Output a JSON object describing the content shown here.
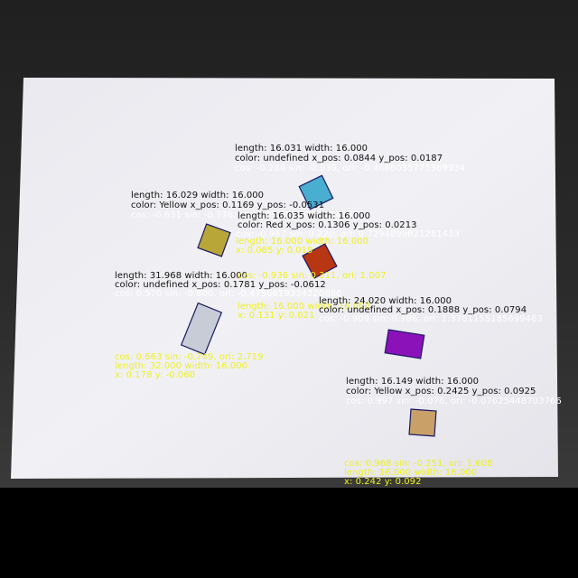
{
  "colors": {
    "paper": "#eeeef2",
    "label_dark": "#111111",
    "label_white": "#ffffff",
    "label_yellow": "#f0f020",
    "outline": "#1a1a66"
  },
  "objects": [
    {
      "name": "cyan",
      "fill": "#4aaed0",
      "lines": {
        "dims": "length: 16.031 width: 16.000",
        "color_pos": "color: undefined x_pos: 0.0844 y_pos: 0.0187",
        "trig": "cos: -0.286 sin: -0.939, ori: -0.4666035771369934"
      }
    },
    {
      "name": "olive",
      "fill": "#b8a638",
      "lines": {
        "dims": "length: 16.029 width: 16.000",
        "color_pos": "color: Yellow x_pos: 0.1169 y_pos: -0.0531",
        "trig": "cos: -0.631 sin: -0.776, ori: 0.8928356178204097"
      }
    },
    {
      "name": "red",
      "fill": "#b83612",
      "lines": {
        "dims": "length: 16.035 width: 16.000",
        "color_pos": "color: Red x_pos: 0.1306 y_pos: 0.0213",
        "trig": "cos: -0.967 sin: 0.220, ori: 0.7294899821281433",
        "overlay_dims": "length: 16.000 width: 16.000",
        "overlay_xy": "x: 0.085 y: 0.019"
      }
    },
    {
      "name": "grey",
      "fill": "#c7ccd6",
      "lines": {
        "dims": "length: 31.968 width: 16.000",
        "color_pos": "color: undefined x_pos: 0.1781 y_pos: -0.0612",
        "trig": "cos: 0.570 sin: -0.800, ori: -0.4756619334220886",
        "overlay_trig": "cos: 0.663 sin: -0.749, ori: 2.719",
        "overlay_dims": "length: 32.000 width: 16.000",
        "overlay_xy": "x: 0.178 y: -0.060",
        "mid_trig": "cos: -0.936 sin: 0.311, ori: 1.007",
        "mid_dims": "length: 16.000 width: 16.000",
        "mid_xy": "x: 0.131 y: 0.021"
      }
    },
    {
      "name": "purple",
      "fill": "#8a12b8",
      "lines": {
        "dims": "length: 24.020 width: 16.000",
        "color_pos": "color: undefined x_pos: 0.1888 y_pos: 0.0794",
        "trig": "cos: -0.909 sin: 0.386, ori: 1.3701155185699463"
      }
    },
    {
      "name": "tan",
      "fill": "#c8a068",
      "lines": {
        "dims": "length: 16.149 width: 16.000",
        "color_pos": "color: Yellow x_pos: 0.2425 y_pos: 0.0925",
        "trig": "cos: 0.997 sin: -0.076, ori: -0.07625448703766",
        "overlay_trig": "cos: 0.968 sin: -0.251, ori: 1.608",
        "overlay_dims": "length: 16.000 width: 16.000",
        "overlay_xy": "x: 0.242 y: 0.092"
      }
    }
  ]
}
